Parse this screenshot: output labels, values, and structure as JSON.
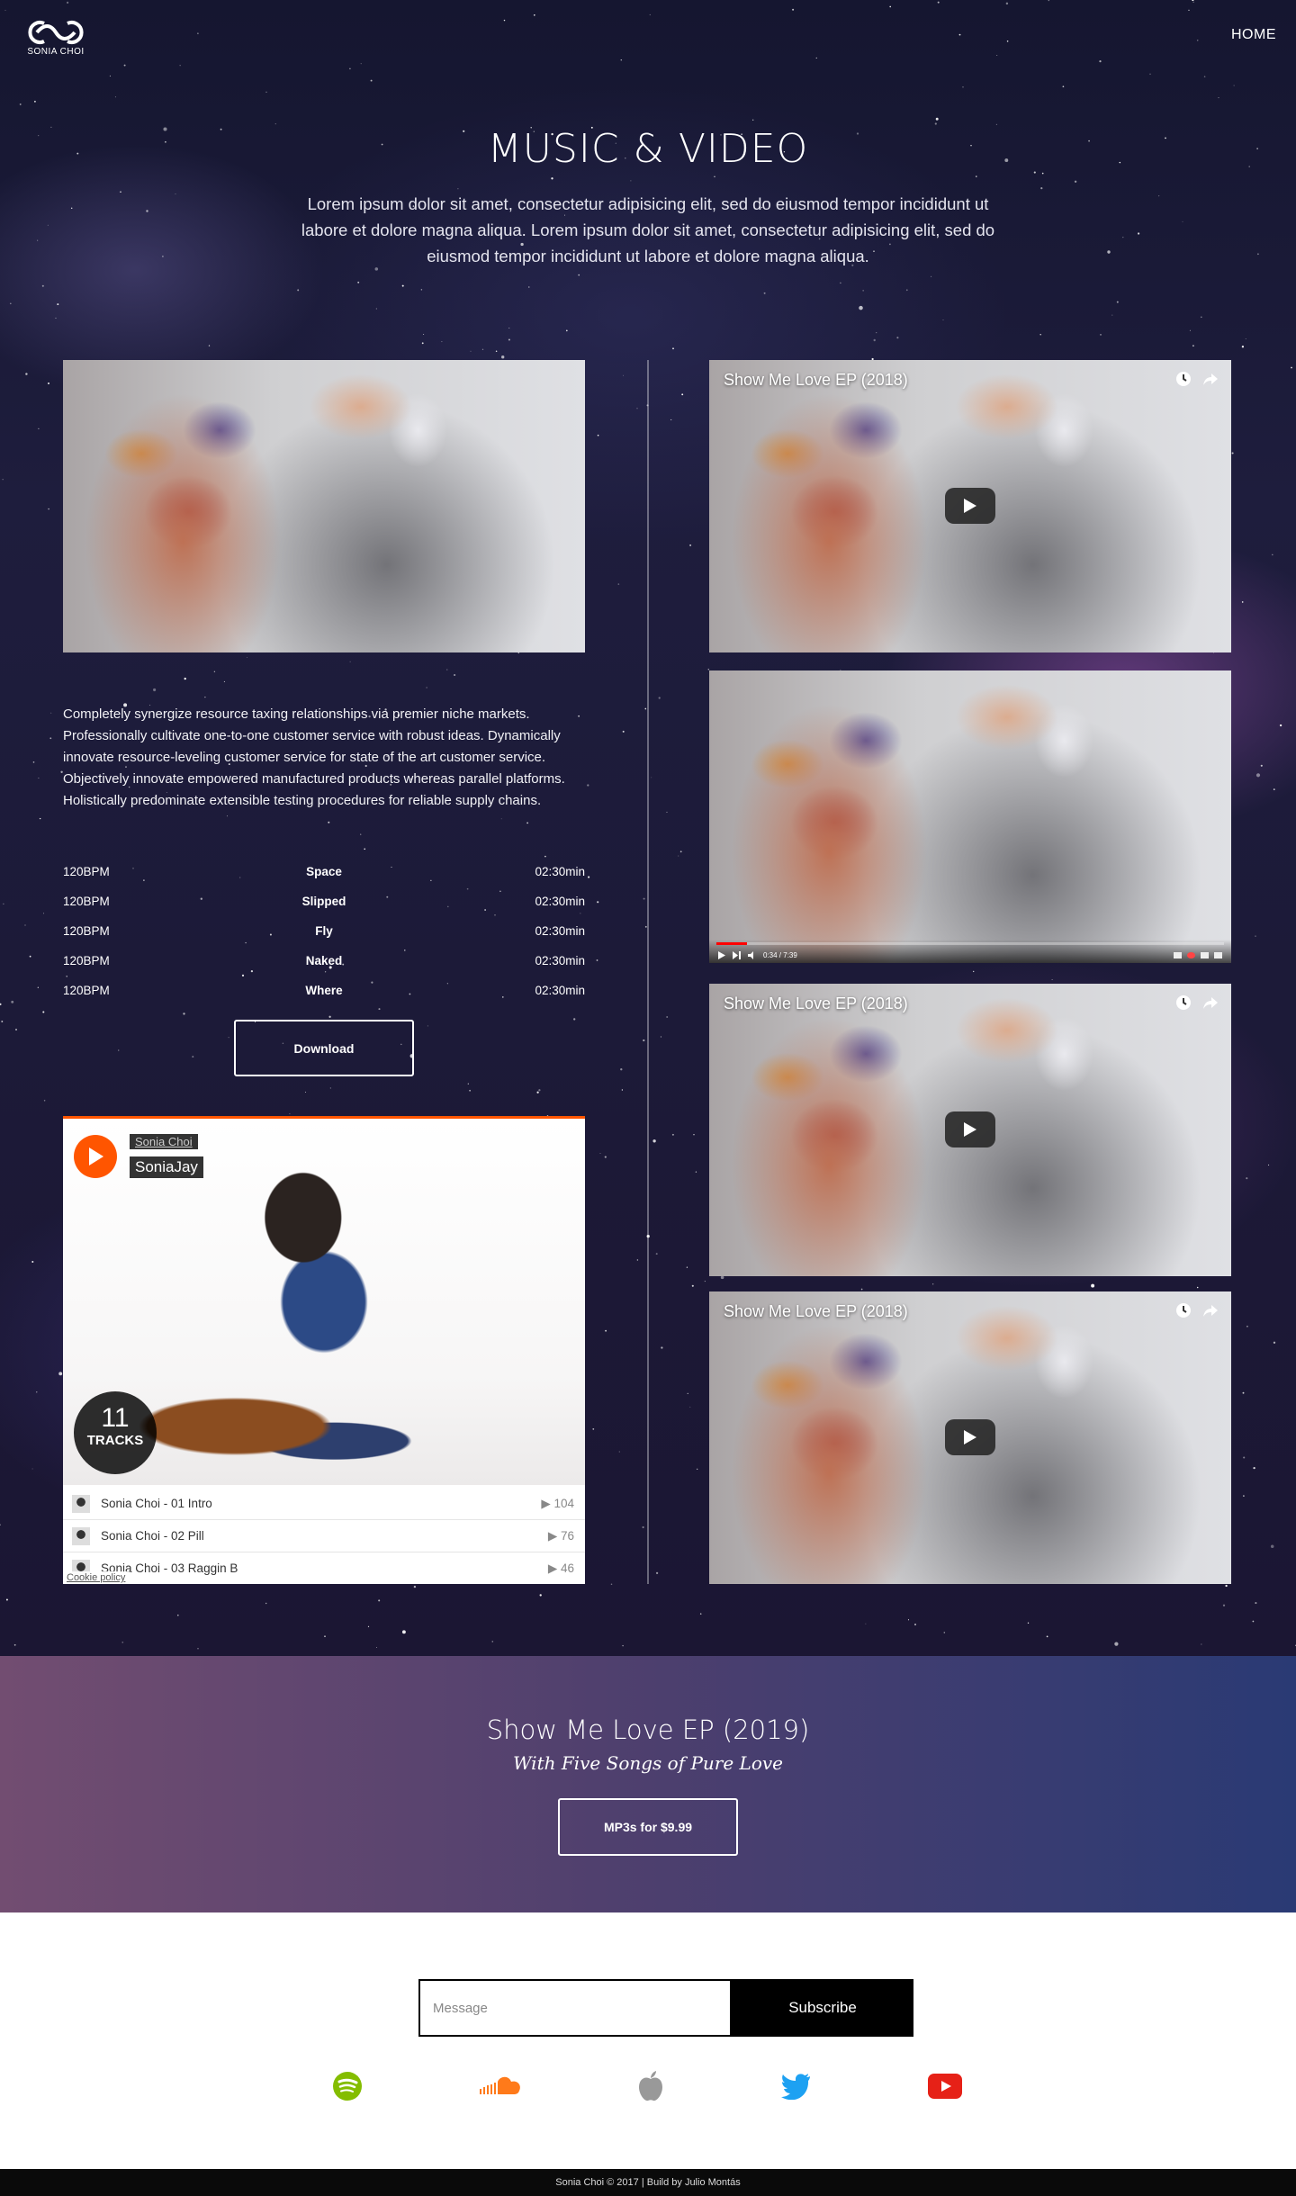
{
  "header": {
    "logo_text": "SONIA CHOI",
    "nav_home": "HOME"
  },
  "hero": {
    "title": "MUSIC & VIDEO",
    "description": "Lorem ipsum dolor sit amet, consectetur adipisicing elit, sed do eiusmod tempor incididunt ut labore et dolore magna aliqua. Lorem ipsum dolor sit amet, consectetur adipisicing elit, sed do eiusmod tempor incididunt ut labore et dolore magna aliqua."
  },
  "album": {
    "body_text": "Completely synergize resource taxing relationships via premier niche markets. Professionally cultivate one-to-one customer service with robust ideas. Dynamically innovate resource-leveling customer service for state of the art customer service. Objectively innovate empowered manufactured products whereas parallel platforms. Holistically predominate extensible testing procedures for reliable supply chains.",
    "tracks": [
      {
        "bpm": "120BPM",
        "name": "Space",
        "time": "02:30min"
      },
      {
        "bpm": "120BPM",
        "name": "Slipped",
        "time": "02:30min"
      },
      {
        "bpm": "120BPM",
        "name": "Fly",
        "time": "02:30min"
      },
      {
        "bpm": "120BPM",
        "name": "Naked",
        "time": "02:30min"
      },
      {
        "bpm": "120BPM",
        "name": "Where",
        "time": "02:30min"
      }
    ],
    "download_label": "Download"
  },
  "soundcloud": {
    "user": "Sonia Choi",
    "title": "SoniaJay",
    "track_count": "11",
    "track_count_label": "TRACKS",
    "tracks": [
      {
        "title": "Sonia Choi - 01 Intro",
        "plays": "104"
      },
      {
        "title": "Sonia Choi - 02 Pill",
        "plays": "76"
      },
      {
        "title": "Sonia Choi - 03 Raggin B",
        "plays": "46"
      }
    ],
    "cookie": "Cookie policy",
    "accent": "#ff5500"
  },
  "videos": [
    {
      "title": "Show Me Love EP (2018)",
      "show_title": true,
      "state": "thumbnail"
    },
    {
      "title": "",
      "show_title": false,
      "state": "playing",
      "time": "0:34 / 7:39",
      "progress": 0.06
    },
    {
      "title": "Show Me Love EP (2018)",
      "show_title": true,
      "state": "thumbnail"
    },
    {
      "title": "Show Me Love EP (2018)",
      "show_title": true,
      "state": "thumbnail"
    }
  ],
  "ep": {
    "title": "Show Me Love EP (2019)",
    "subtitle": "With Five Songs of Pure Love",
    "button_label": "MP3s for $9.99"
  },
  "subscribe": {
    "placeholder": "Message",
    "button_label": "Subscribe"
  },
  "socials": [
    {
      "icon": "spotify-icon",
      "color": "#84bd00"
    },
    {
      "icon": "soundcloud-icon",
      "color": "#ff7a1a"
    },
    {
      "icon": "apple-icon",
      "color": "#999999"
    },
    {
      "icon": "twitter-icon",
      "color": "#1da1f2"
    },
    {
      "icon": "youtube-icon",
      "color": "#e62117"
    }
  ],
  "footer": {
    "text": "Sonia Choi © 2017 | Build by Julio Montás"
  }
}
